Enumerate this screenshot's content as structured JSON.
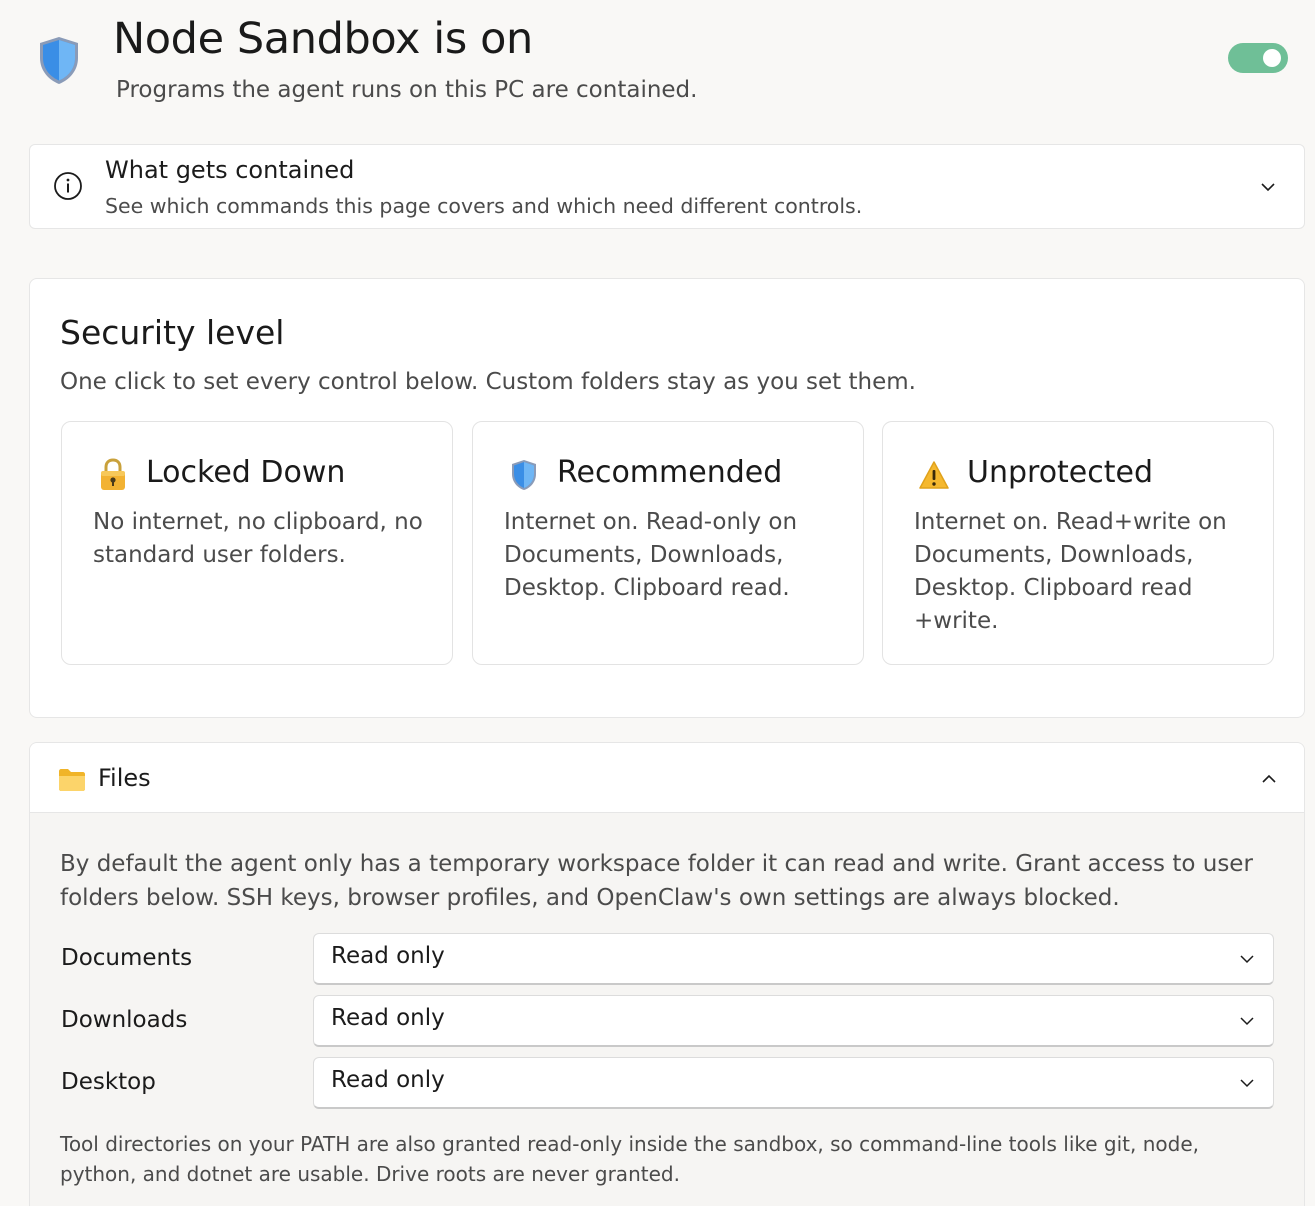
{
  "header": {
    "title": "Node Sandbox is on",
    "subtitle": "Programs the agent runs on this PC are contained.",
    "icon": "shield-icon",
    "toggle_on": true,
    "toggle_color": "#6fbf97"
  },
  "info": {
    "title": "What gets contained",
    "subtitle": "See which commands this page covers and which need different controls.",
    "icon": "info-icon",
    "expanded": false
  },
  "security": {
    "title": "Security level",
    "subtitle": "One click to set every control below. Custom folders stay as you set them.",
    "levels": [
      {
        "icon": "lock-icon",
        "title": "Locked Down",
        "description": "No internet, no clipboard, no standard user folders."
      },
      {
        "icon": "shield-icon",
        "title": "Recommended",
        "description": "Internet on. Read-only on Documents, Downloads, Desktop. Clipboard read."
      },
      {
        "icon": "warning-icon",
        "title": "Unprotected",
        "description": "Internet on. Read+write on Documents, Downloads, Desktop. Clipboard read +write."
      }
    ]
  },
  "files": {
    "title": "Files",
    "icon": "folder-icon",
    "expanded": true,
    "description": "By default the agent only has a temporary workspace folder it can read and write. Grant access to user folders below. SSH keys, browser profiles, and OpenClaw's own settings are always blocked.",
    "folders": [
      {
        "label": "Documents",
        "value": "Read only"
      },
      {
        "label": "Downloads",
        "value": "Read only"
      },
      {
        "label": "Desktop",
        "value": "Read only"
      }
    ],
    "note": "Tool directories on your PATH are also granted read-only inside the sandbox, so command-line tools like git, node, python, and dotnet are usable. Drive roots are never granted."
  }
}
